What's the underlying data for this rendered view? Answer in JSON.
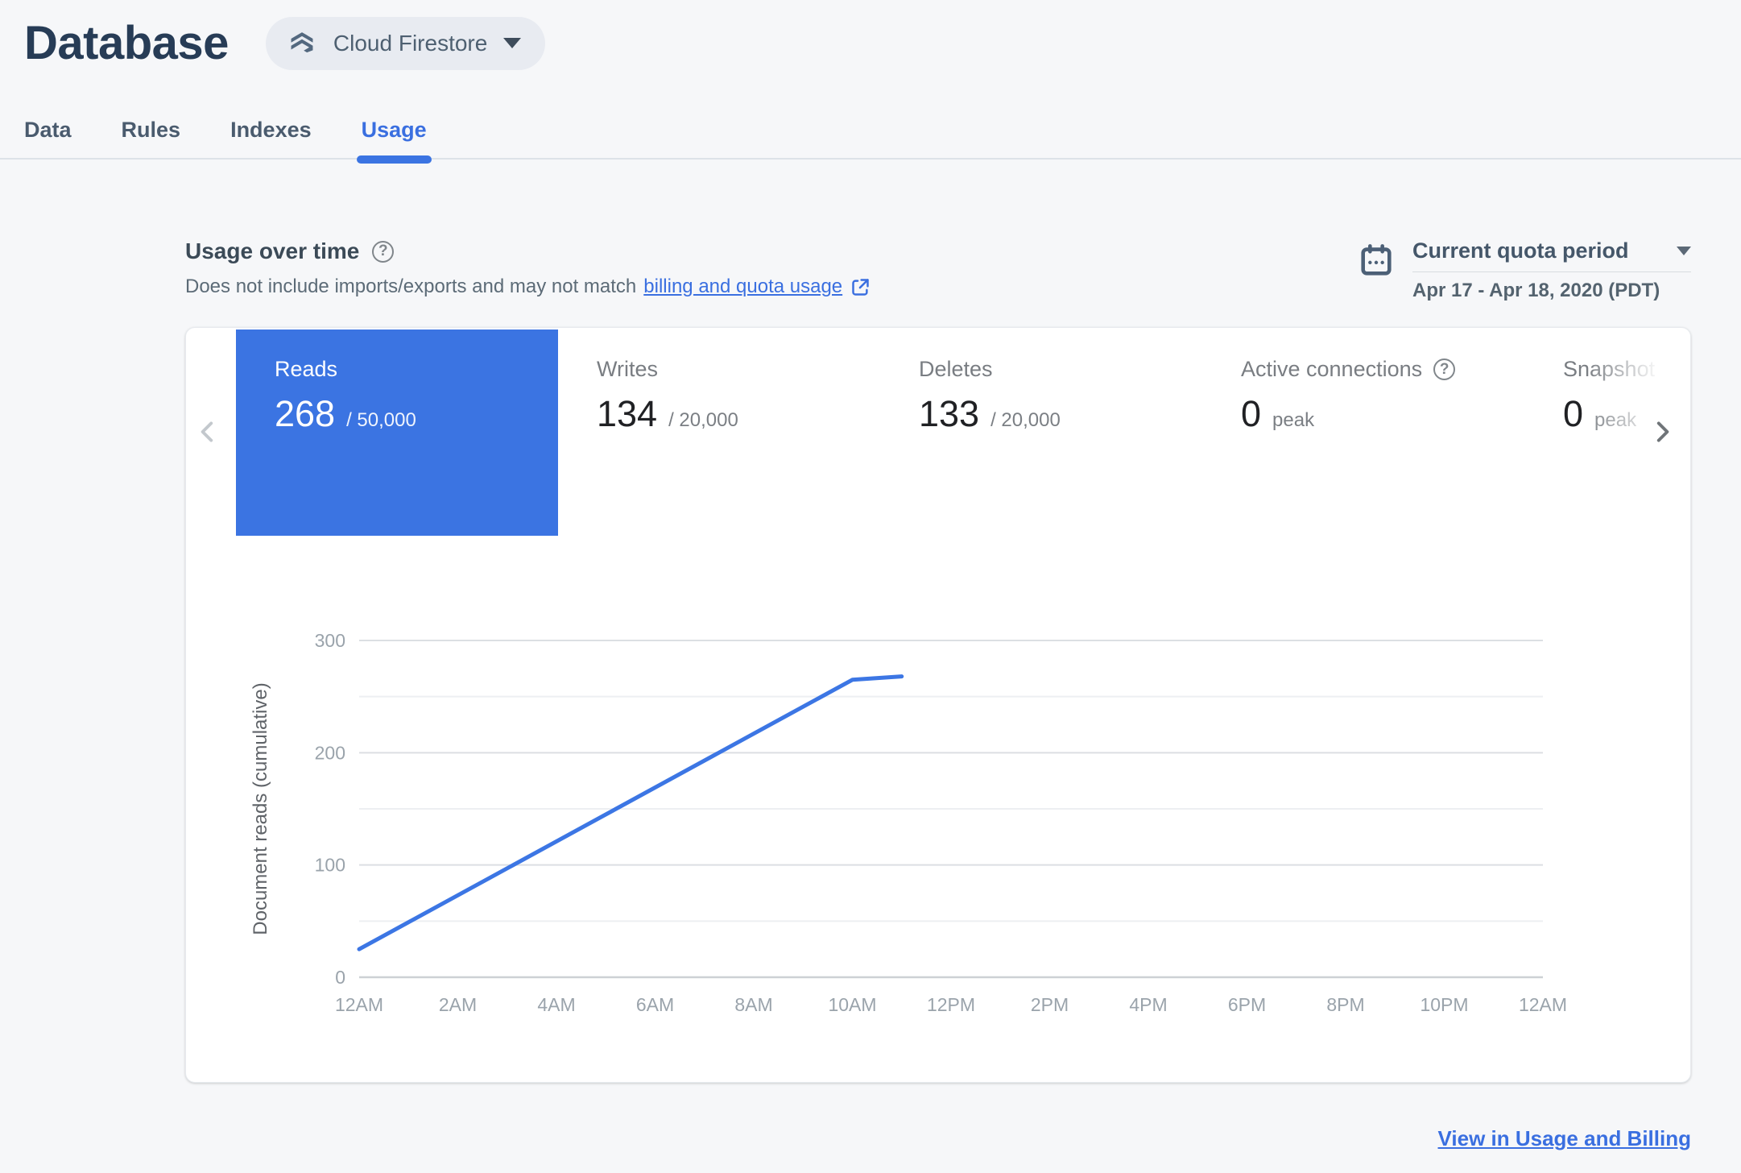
{
  "header": {
    "title": "Database",
    "product_label": "Cloud Firestore"
  },
  "tabs": [
    {
      "label": "Data",
      "active": false
    },
    {
      "label": "Rules",
      "active": false
    },
    {
      "label": "Indexes",
      "active": false
    },
    {
      "label": "Usage",
      "active": true
    }
  ],
  "usage": {
    "title": "Usage over time",
    "subtitle_text": "Does not include imports/exports and may not match",
    "subtitle_link_label": "billing and quota usage",
    "period_label": "Current quota period",
    "period_value": "Apr 17 - Apr 18, 2020 (PDT)"
  },
  "metrics": [
    {
      "label": "Reads",
      "value": "268",
      "suffix": "/ 50,000",
      "selected": true,
      "has_help": false
    },
    {
      "label": "Writes",
      "value": "134",
      "suffix": "/ 20,000",
      "selected": false,
      "has_help": false
    },
    {
      "label": "Deletes",
      "value": "133",
      "suffix": "/ 20,000",
      "selected": false,
      "has_help": false
    },
    {
      "label": "Active connections",
      "value": "0",
      "suffix": "peak",
      "selected": false,
      "has_help": true
    },
    {
      "label": "Snapshot listeners",
      "value": "0",
      "suffix": "peak",
      "selected": false,
      "has_help": false
    }
  ],
  "footer": {
    "link_label": "View in Usage and Billing"
  },
  "icons": {
    "product": "firestore-icon",
    "selector_caret": "chevron-down-icon",
    "section_help": "help-icon",
    "subtitle_external": "external-link-icon",
    "period_calendar": "calendar-icon",
    "carousel_left": "chevron-left-icon",
    "carousel_right": "chevron-right-icon",
    "active_connections_help": "help-icon"
  },
  "colors": {
    "accent_blue": "#3B74E2",
    "link_blue": "#3A6FE0",
    "navy_heading": "#273C56",
    "page_bg": "#F6F7F9",
    "grid_major": "#DCDFE3",
    "grid_minor": "#EDEFF2",
    "axis_line": "#CDD1D5",
    "tick_text": "#9AA3AB"
  },
  "chart_data": {
    "type": "line",
    "title": "",
    "xlabel": "",
    "ylabel": "Document reads (cumulative)",
    "ylim": [
      0,
      300
    ],
    "yticks": [
      0,
      100,
      200,
      300
    ],
    "minor_grid_step": 50,
    "grid": "horizontal-only",
    "legend_position": "none",
    "x_hours_span": 24,
    "x_tick_labels": [
      "12AM",
      "2AM",
      "4AM",
      "6AM",
      "8AM",
      "10AM",
      "12PM",
      "2PM",
      "4PM",
      "6PM",
      "8PM",
      "10PM",
      "12AM"
    ],
    "series": [
      {
        "name": "Document reads (cumulative)",
        "color": "#3C76E4",
        "points": [
          {
            "hour": 0,
            "value": 25
          },
          {
            "hour": 10,
            "value": 265
          },
          {
            "hour": 11,
            "value": 268
          }
        ]
      }
    ]
  }
}
